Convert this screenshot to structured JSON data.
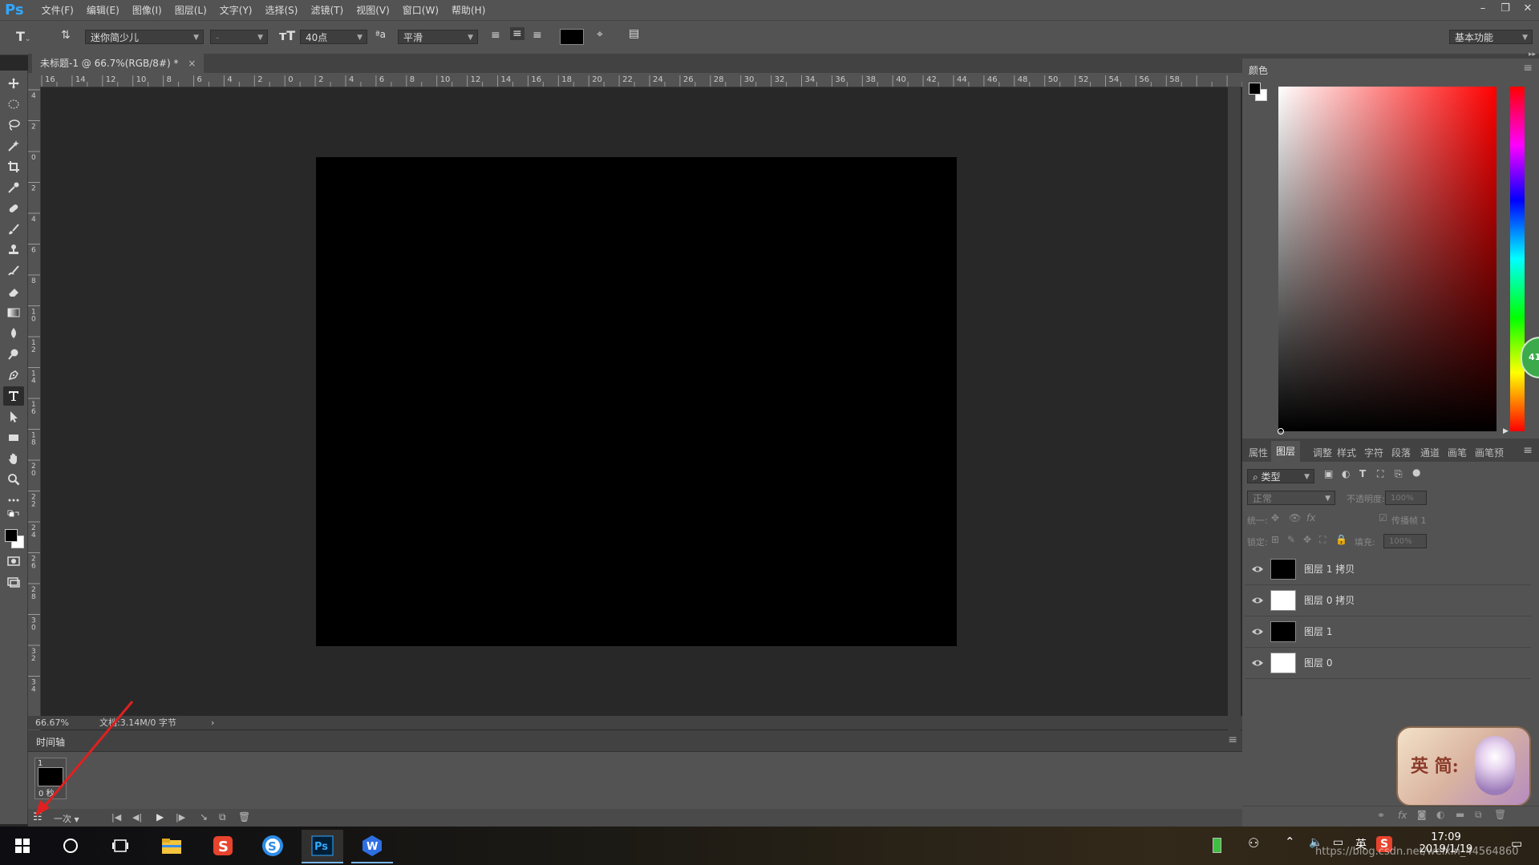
{
  "app": {
    "logo": "Ps",
    "menu": [
      "文件(F)",
      "编辑(E)",
      "图像(I)",
      "图层(L)",
      "文字(Y)",
      "选择(S)",
      "滤镜(T)",
      "视图(V)",
      "窗口(W)",
      "帮助(H)"
    ],
    "window_controls": [
      "–",
      "❐",
      "✕"
    ]
  },
  "options_bar": {
    "font_family": "迷你简少儿",
    "font_style": "-",
    "font_size": "40点",
    "aa_icon_label": "ªa",
    "antialias": "平滑",
    "text_color": "#000000",
    "workspace": "基本功能"
  },
  "document": {
    "tab_title": "未标题-1 @ 66.7%(RGB/8#) *",
    "tab_close": "×",
    "zoom": "66.67%",
    "doc_info": "文档:3.14M/0 字节",
    "status_arrow": "›",
    "canvas_color": "#000000",
    "ruler_h_labels": [
      "16",
      "14",
      "12",
      "10",
      "8",
      "6",
      "4",
      "2",
      "0",
      "2",
      "4",
      "6",
      "8",
      "10",
      "12",
      "14",
      "16",
      "18",
      "20",
      "22",
      "24",
      "26",
      "28",
      "30",
      "32",
      "34",
      "36",
      "38",
      "40",
      "42",
      "44",
      "46",
      "48",
      "50",
      "52",
      "54",
      "56",
      "58"
    ],
    "ruler_v_labels": [
      "4",
      "2",
      "0",
      "2",
      "4",
      "6",
      "8",
      "10",
      "12",
      "14",
      "16",
      "18",
      "20",
      "22",
      "24",
      "26",
      "28",
      "30",
      "32",
      "34"
    ]
  },
  "timeline": {
    "title": "时间轴",
    "frame_number": "1",
    "frame_delay": "0 秒",
    "loop": "一次"
  },
  "color_panel": {
    "title": "颜色",
    "foreground": "#000000",
    "background": "#ffffff",
    "hue_color": "#ff0000"
  },
  "layers_panel": {
    "tabs": [
      "属性",
      "图层",
      "调整",
      "样式",
      "字符",
      "段落",
      "通道",
      "画笔",
      "画笔预"
    ],
    "active_tab": "图层",
    "filter_kind": "类型",
    "blend_mode": "正常",
    "opacity_label": "不透明度:",
    "opacity_value": "100%",
    "unify_label": "统一:",
    "propagate_label": "传播帧 1",
    "lock_label": "锁定:",
    "fill_label": "填充:",
    "fill_value": "100%",
    "layers": [
      {
        "name": "图层 1 拷贝",
        "thumb": "#000000"
      },
      {
        "name": "图层 0 拷贝",
        "thumb": "#ffffff"
      },
      {
        "name": "图层 1",
        "thumb": "#000000"
      },
      {
        "name": "图层 0",
        "thumb": "#ffffff"
      }
    ],
    "badge_text": "英 简:",
    "green_badge": "41"
  },
  "taskbar": {
    "clock_time": "17:09",
    "clock_date": "2019/1/19",
    "ime_label": "英",
    "watermark": "https://blog.csdn.net/weixin_44564860"
  }
}
